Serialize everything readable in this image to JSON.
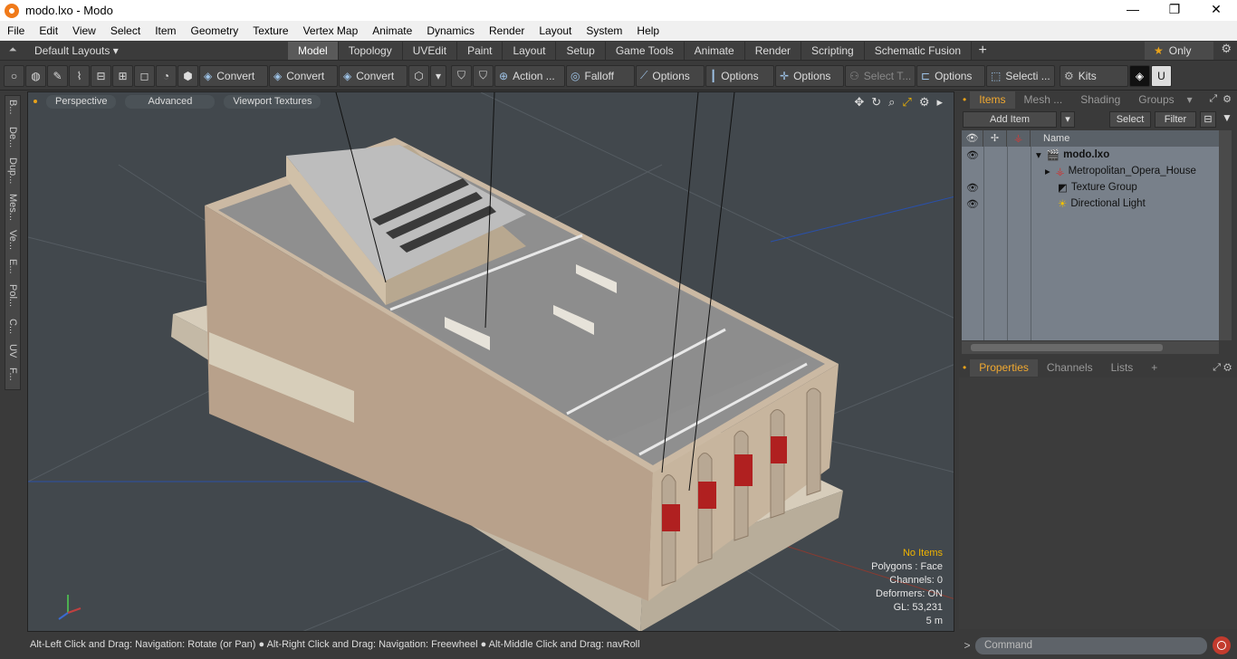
{
  "window": {
    "title": "modo.lxo - Modo",
    "controls": [
      "—",
      "❐",
      "✕"
    ]
  },
  "menu": [
    "File",
    "Edit",
    "View",
    "Select",
    "Item",
    "Geometry",
    "Texture",
    "Vertex Map",
    "Animate",
    "Dynamics",
    "Render",
    "Layout",
    "System",
    "Help"
  ],
  "layouts": {
    "selector": "Default Layouts ▾",
    "tabs": [
      "Model",
      "Topology",
      "UVEdit",
      "Paint",
      "Layout",
      "Setup",
      "Game Tools",
      "Animate",
      "Render",
      "Scripting",
      "Schematic Fusion"
    ],
    "active_tab": "Model",
    "plus": "+",
    "only": "Only"
  },
  "toolbar": {
    "convert1": "Convert",
    "convert2": "Convert",
    "convert3": "Convert",
    "action": "Action",
    "falloff": "Falloff",
    "options1": "Options",
    "options2": "Options",
    "options3": "Options",
    "select_t": "Select T...",
    "options4": "Options",
    "selecti": "Selecti ...",
    "kits": "Kits"
  },
  "left_tabs": [
    "B...",
    "De...",
    "Dup...",
    "Mes...",
    "Ve...",
    "E...",
    "Pol...",
    "C...",
    "UV",
    "F..."
  ],
  "viewport": {
    "buttons": [
      "Perspective",
      "Advanced",
      "Viewport Textures"
    ],
    "info": {
      "no_items": "No Items",
      "polygons": "Polygons : Face",
      "channels": "Channels: 0",
      "deformers": "Deformers: ON",
      "gl": "GL: 53,231",
      "scale": "5 m"
    }
  },
  "status": "Alt-Left Click and Drag: Navigation: Rotate (or Pan) ● Alt-Right Click and Drag: Navigation: Freewheel ● Alt-Middle Click and Drag: navRoll",
  "items_panel": {
    "tabs": [
      "Items",
      "Mesh ...",
      "Shading",
      "Groups"
    ],
    "active_tab": "Items",
    "add_item": "Add Item",
    "select": "Select",
    "filter": "Filter",
    "col_name": "Name",
    "rows": [
      {
        "name": "modo.lxo",
        "eye": true
      },
      {
        "name": "Metropolitan_Opera_House",
        "eye": false
      },
      {
        "name": "Texture Group",
        "eye": true
      },
      {
        "name": "Directional Light",
        "eye": true
      }
    ]
  },
  "props_panel": {
    "tabs": [
      "Properties",
      "Channels",
      "Lists"
    ],
    "active_tab": "Properties",
    "plus": "+"
  },
  "command": {
    "placeholder": "Command",
    "prompt": ">"
  }
}
